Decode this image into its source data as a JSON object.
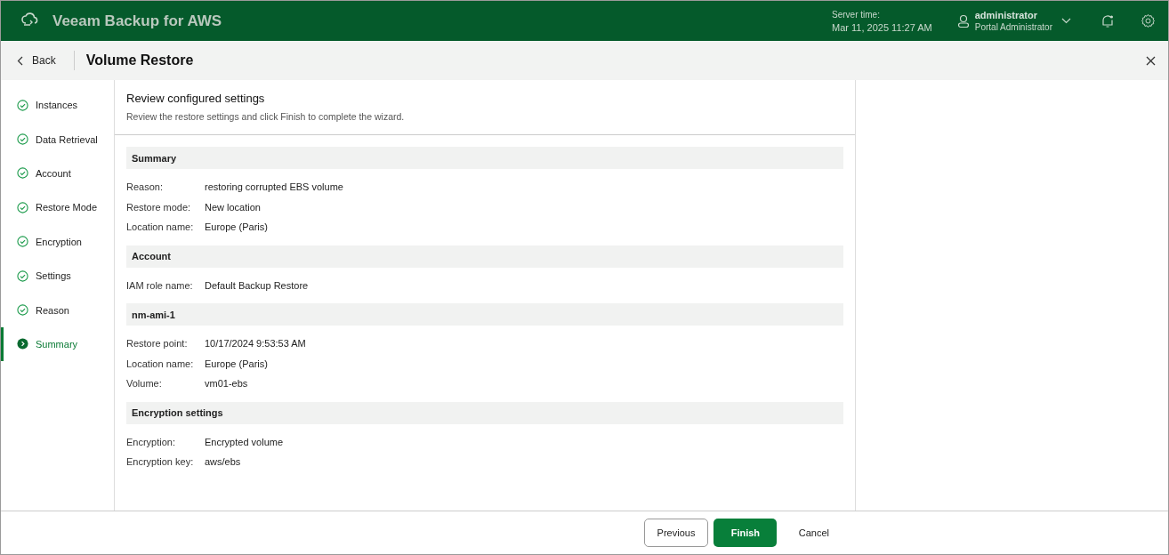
{
  "app": {
    "title": "Veeam Backup for AWS",
    "server_time_label": "Server time:",
    "server_time": "Mar 11, 2025 11:27 AM",
    "user": {
      "name": "administrator",
      "role": "Portal Administrator"
    }
  },
  "dialog": {
    "back": "Back",
    "title": "Volume Restore"
  },
  "steps": [
    {
      "label": "Instances",
      "done": true,
      "selected": false
    },
    {
      "label": "Data Retrieval",
      "done": true,
      "selected": false
    },
    {
      "label": "Account",
      "done": true,
      "selected": false
    },
    {
      "label": "Restore Mode",
      "done": true,
      "selected": false
    },
    {
      "label": "Encryption",
      "done": true,
      "selected": false
    },
    {
      "label": "Settings",
      "done": true,
      "selected": false
    },
    {
      "label": "Reason",
      "done": true,
      "selected": false
    },
    {
      "label": "Summary",
      "done": false,
      "selected": true
    }
  ],
  "page": {
    "title": "Review configured settings",
    "description": "Review the restore settings and click Finish to complete the wizard."
  },
  "sections": [
    {
      "title": "Summary",
      "rows": [
        {
          "label": "Reason:",
          "value": "restoring corrupted EBS volume"
        },
        {
          "label": "Restore mode:",
          "value": "New location"
        },
        {
          "label": "Location name:",
          "value": "Europe (Paris)"
        }
      ]
    },
    {
      "title": "Account",
      "rows": [
        {
          "label": "IAM role name:",
          "value": "Default Backup Restore"
        }
      ]
    },
    {
      "title": "nm-ami-1",
      "rows": [
        {
          "label": "Restore point:",
          "value": "10/17/2024 9:53:53 AM"
        },
        {
          "label": "Location name:",
          "value": "Europe (Paris)"
        },
        {
          "label": "Volume:",
          "value": "vm01-ebs"
        }
      ]
    },
    {
      "title": "Encryption settings",
      "rows": [
        {
          "label": "Encryption:",
          "value": "Encrypted volume"
        },
        {
          "label": "Encryption key:",
          "value": "aws/ebs"
        }
      ]
    }
  ],
  "buttons": [
    {
      "label": "Previous",
      "kind": "secondary"
    },
    {
      "label": "Finish",
      "kind": "primary"
    },
    {
      "label": "Cancel",
      "kind": "plain"
    }
  ]
}
